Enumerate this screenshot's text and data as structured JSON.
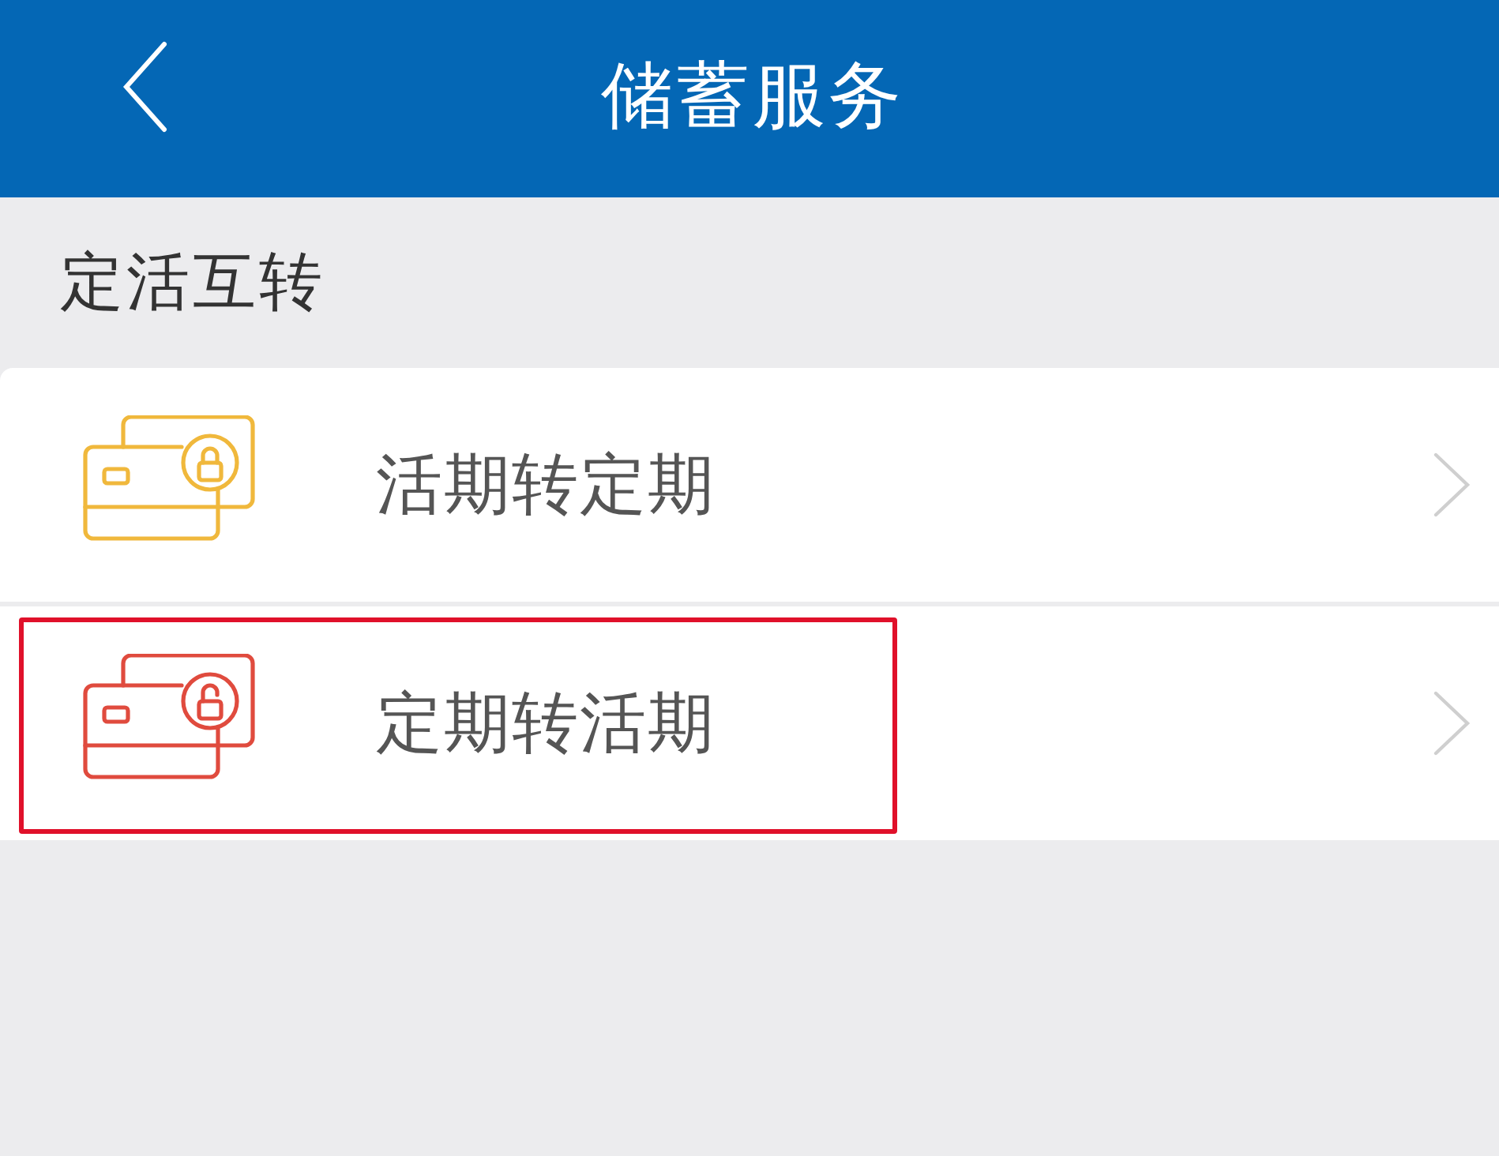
{
  "header": {
    "title": "储蓄服务"
  },
  "section": {
    "title": "定活互转"
  },
  "items": [
    {
      "label": "活期转定期",
      "kind": "locked",
      "color": "#f0b83c",
      "highlighted": false
    },
    {
      "label": "定期转活期",
      "kind": "unlocked",
      "color": "#e04b3e",
      "highlighted": true
    }
  ]
}
